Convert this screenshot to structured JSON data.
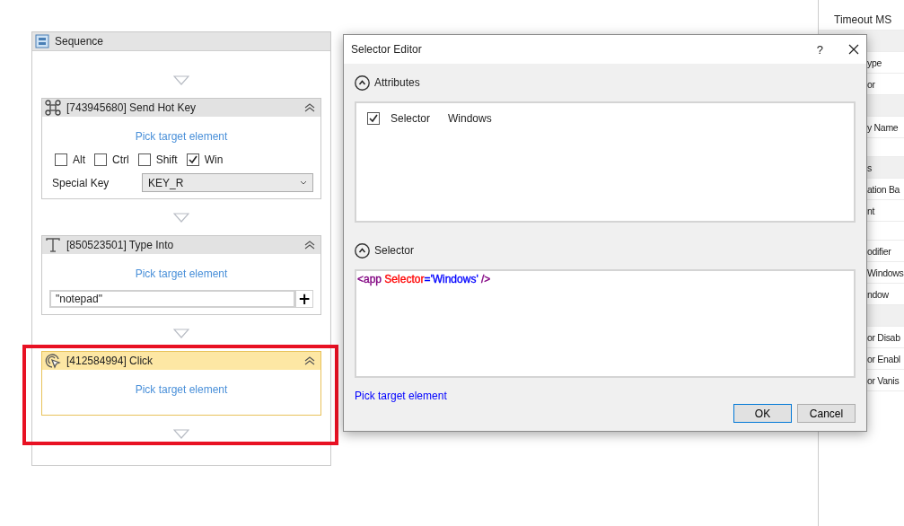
{
  "sequence": {
    "title": "Sequence",
    "activities": [
      {
        "kind": "hotkey",
        "title": "[743945680] Send Hot Key",
        "selected": false,
        "link": "Pick target element",
        "modifiers": [
          {
            "label": "Alt",
            "checked": false
          },
          {
            "label": "Ctrl",
            "checked": false
          },
          {
            "label": "Shift",
            "checked": false
          },
          {
            "label": "Win",
            "checked": true
          }
        ],
        "special_key_label": "Special Key",
        "special_key": "KEY_R"
      },
      {
        "kind": "type",
        "title": "[850523501] Type Into",
        "selected": false,
        "link": "Pick target element",
        "text": "\"notepad\"",
        "add": "+"
      },
      {
        "kind": "click",
        "title": "[412584994] Click",
        "selected": true,
        "link": "Pick target element"
      }
    ]
  },
  "dialog": {
    "title": "Selector Editor",
    "help": "?",
    "attributes_label": "Attributes",
    "attributes": [
      {
        "checked": true,
        "name": "Selector",
        "value": "Windows"
      }
    ],
    "selector_label": "Selector",
    "selector_tokens": [
      {
        "text": "<app",
        "color": "#800080"
      },
      {
        "text": " Selector",
        "color": "#ff0000"
      },
      {
        "text": "=",
        "color": "#0000ff"
      },
      {
        "text": "'Windows'",
        "color": "#0000ff"
      },
      {
        "text": " />",
        "color": "#800080"
      }
    ],
    "link": "Pick target element",
    "buttons": [
      {
        "label": "OK",
        "default": true
      },
      {
        "label": "Cancel",
        "default": false
      }
    ]
  },
  "properties": {
    "rows": [
      {
        "kind": "row",
        "label": "Timeout MS"
      },
      {
        "kind": "header"
      },
      {
        "kind": "partial",
        "label": "ype"
      },
      {
        "kind": "partial",
        "label": "or"
      },
      {
        "kind": "header"
      },
      {
        "kind": "partial",
        "label": "y Name"
      },
      {
        "kind": "blank"
      },
      {
        "kind": "partial_header",
        "label": "s"
      },
      {
        "kind": "partial",
        "label": "ation Ba"
      },
      {
        "kind": "partial",
        "label": "nt"
      },
      {
        "kind": "blank"
      },
      {
        "kind": "partial",
        "label": "odifier"
      },
      {
        "kind": "partial",
        "label": "Windows"
      },
      {
        "kind": "partial",
        "label": "ndow"
      },
      {
        "kind": "header"
      },
      {
        "kind": "partial",
        "label": "or Disab"
      },
      {
        "kind": "partial",
        "label": "or Enabl"
      },
      {
        "kind": "partial",
        "label": "or Vanis"
      }
    ]
  }
}
